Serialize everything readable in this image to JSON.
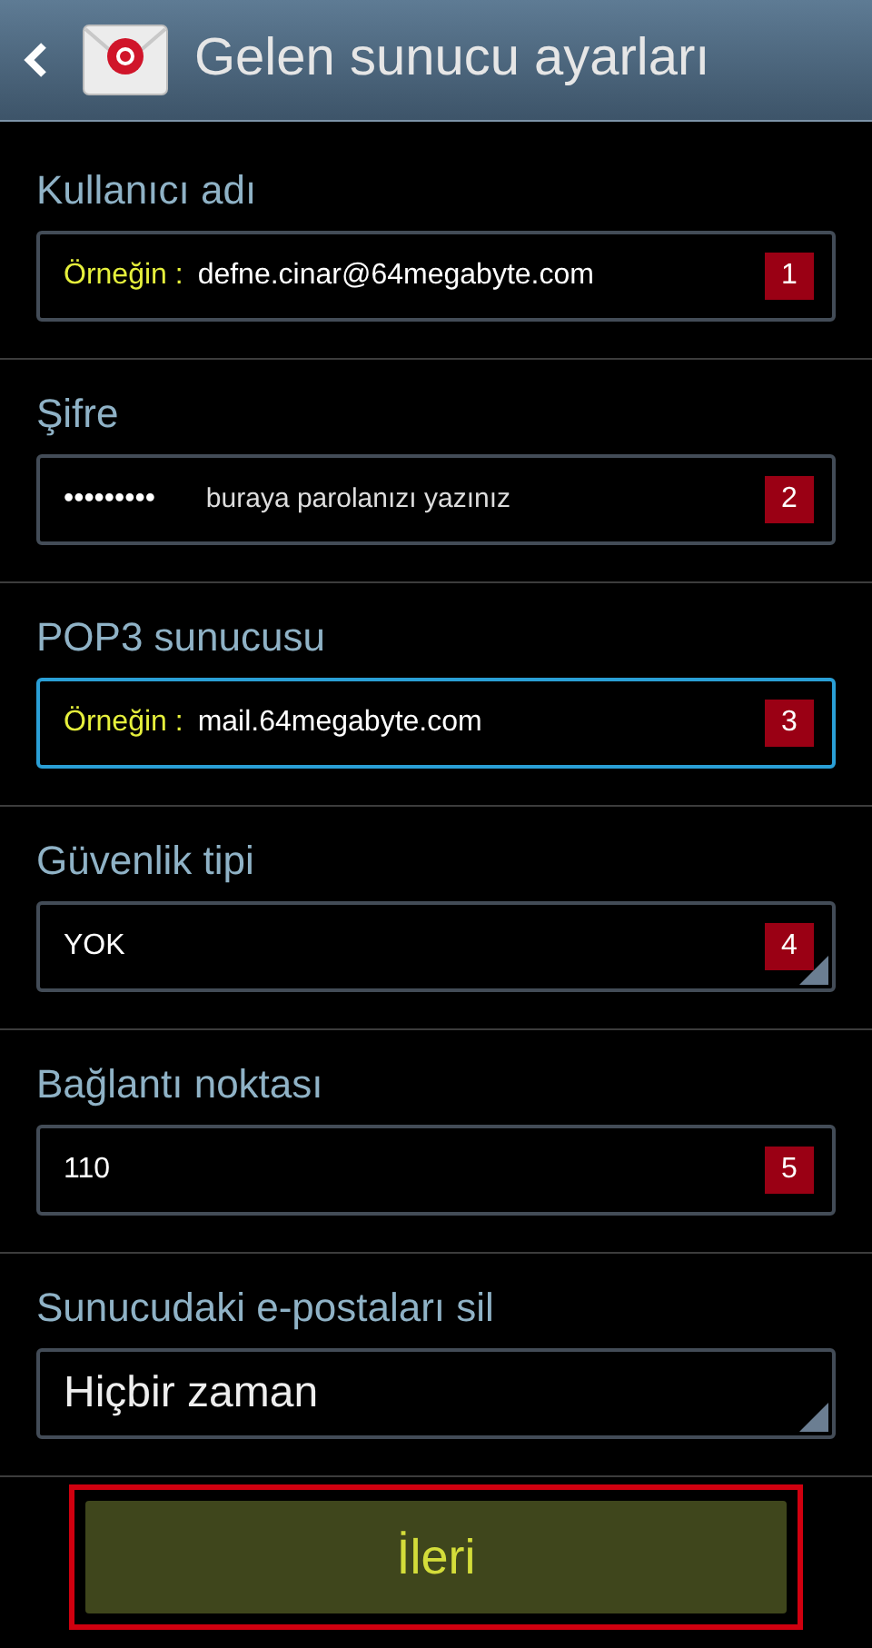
{
  "header": {
    "title": "Gelen sunucu ayarları"
  },
  "fields": [
    {
      "label": "Kullanıcı adı",
      "kind": "text",
      "hint": "Örneğin :",
      "value": "defne.cinar@64megabyte.com",
      "badge": "1",
      "focused": false
    },
    {
      "label": "Şifre",
      "kind": "text",
      "value": "•••••••••",
      "note": "buraya parolanızı yazınız",
      "badge": "2",
      "focused": false
    },
    {
      "label": "POP3 sunucusu",
      "kind": "text",
      "hint": "Örneğin :",
      "value": "mail.64megabyte.com",
      "badge": "3",
      "focused": true
    },
    {
      "label": "Güvenlik tipi",
      "kind": "dropdown",
      "value": "YOK",
      "badge": "4",
      "focused": false
    },
    {
      "label": "Bağlantı noktası",
      "kind": "text",
      "value": "110",
      "badge": "5",
      "focused": false
    },
    {
      "label": "Sunucudaki e-postaları sil",
      "kind": "select",
      "value": "Hiçbir zaman",
      "focused": false
    }
  ],
  "next_button": {
    "label": "İleri",
    "highlighted": true
  }
}
